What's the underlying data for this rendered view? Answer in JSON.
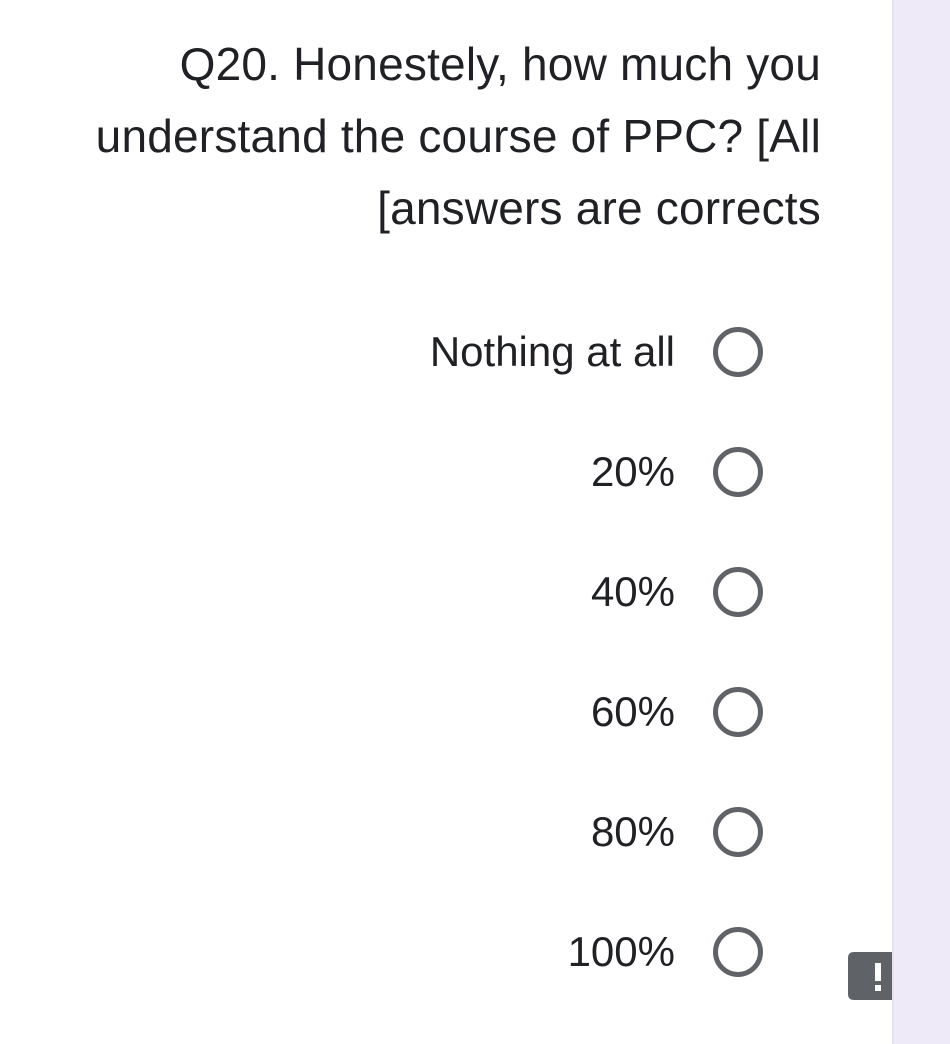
{
  "question": {
    "title": "Q20. Honestely, how much you understand the course of PPC? [All [answers are corrects"
  },
  "options": [
    {
      "label": "Nothing at all",
      "selected": false
    },
    {
      "label": "20%",
      "selected": false
    },
    {
      "label": "40%",
      "selected": false
    },
    {
      "label": "60%",
      "selected": false
    },
    {
      "label": "80%",
      "selected": false
    },
    {
      "label": "100%",
      "selected": false
    }
  ],
  "icons": {
    "report": "report-problem-icon",
    "radio": "radio-unchecked-icon"
  },
  "colors": {
    "text": "#202124",
    "radio_border": "#5f6368",
    "side_strip": "#eeeaf8",
    "report_icon": "#5f6368"
  }
}
